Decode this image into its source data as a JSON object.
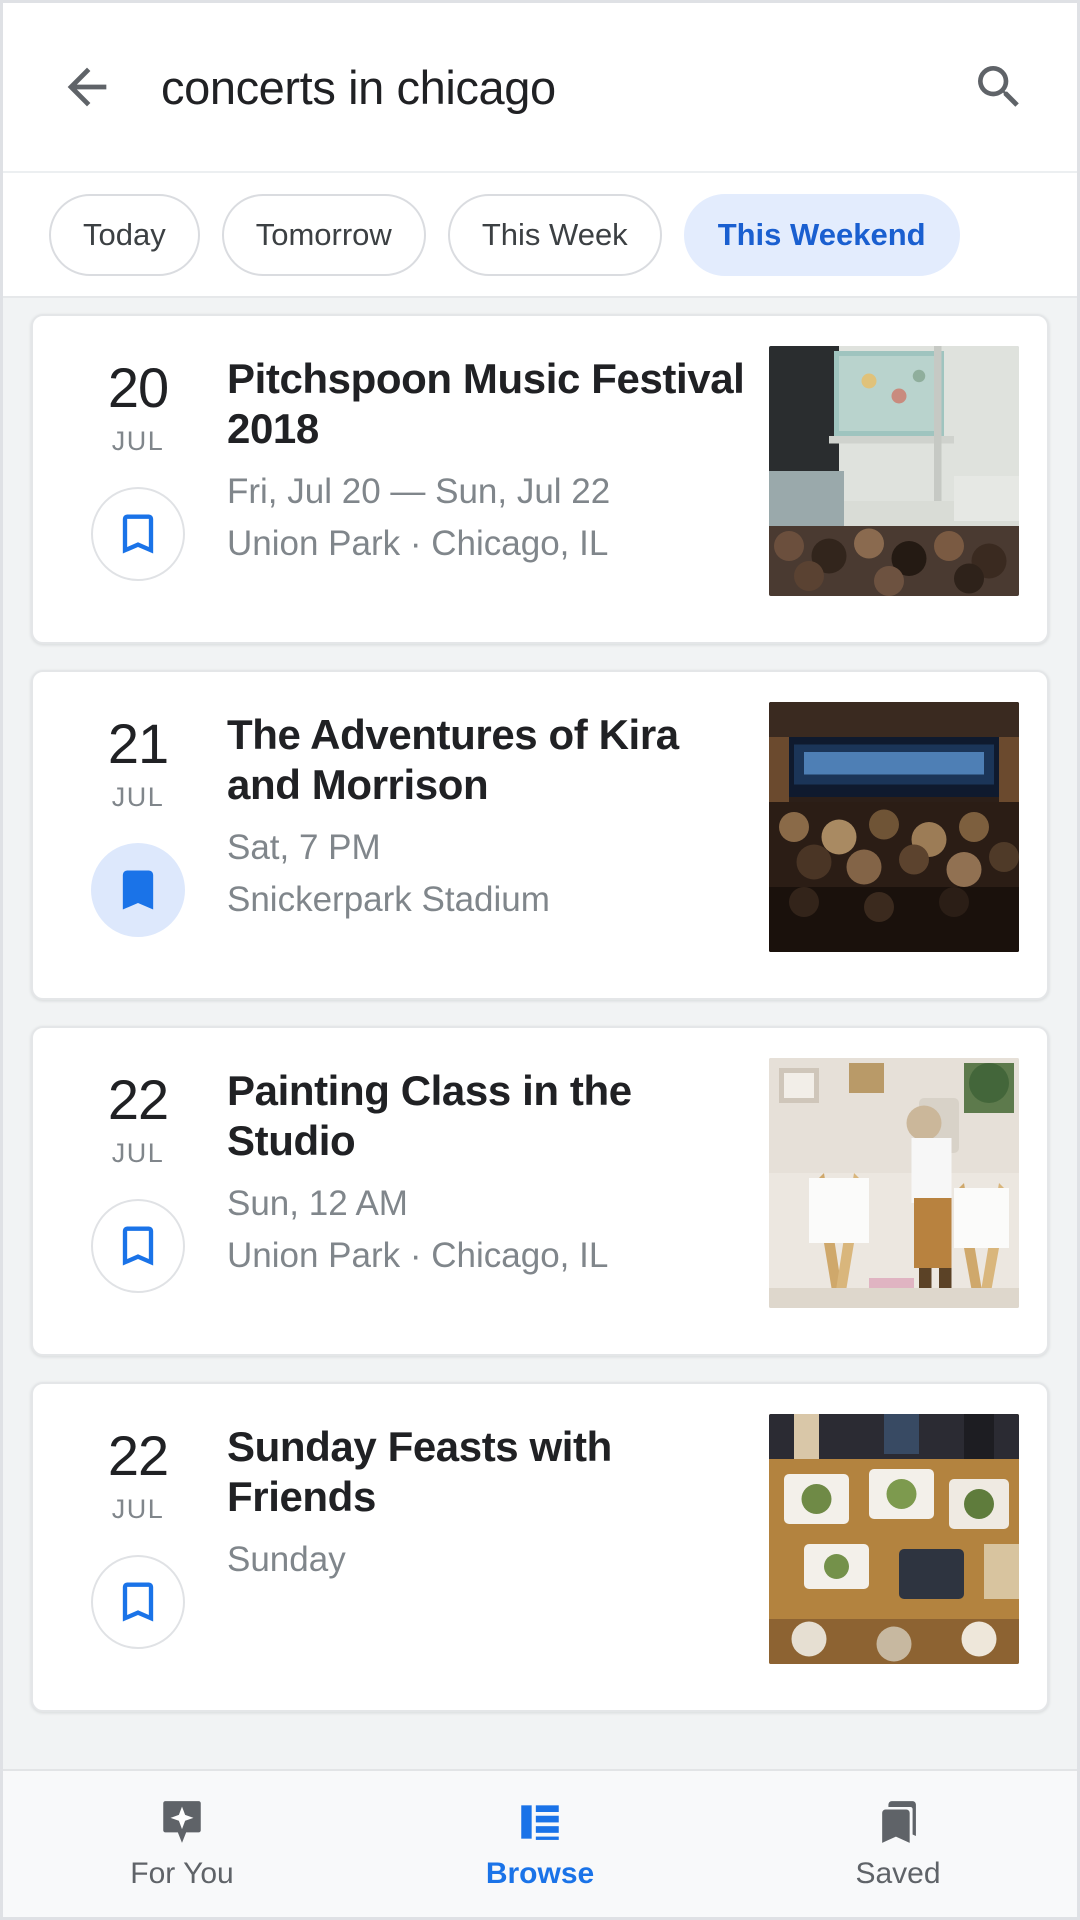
{
  "search": {
    "query": "concerts in chicago",
    "back_icon": "arrow-left-icon",
    "search_icon": "search-icon"
  },
  "filters": {
    "chips": [
      {
        "label": "Today",
        "selected": false
      },
      {
        "label": "Tomorrow",
        "selected": false
      },
      {
        "label": "This Week",
        "selected": false
      },
      {
        "label": "This Weekend",
        "selected": true
      }
    ]
  },
  "events": [
    {
      "day": "20",
      "month": "JUL",
      "title": "Pitchspoon Music Festival 2018",
      "when": "Fri, Jul 20 — Sun, Jul 22",
      "where": "Union Park · Chicago, IL",
      "saved": false,
      "thumb": "music-festival-crowd-photo"
    },
    {
      "day": "21",
      "month": "JUL",
      "title": "The Adventures of Kira and Morrison",
      "when": "Sat, 7 PM",
      "where": "Snickerpark Stadium",
      "saved": true,
      "thumb": "concert-hall-audience-photo"
    },
    {
      "day": "22",
      "month": "JUL",
      "title": "Painting Class in the Studio",
      "when": "Sun, 12 AM",
      "where": "Union Park · Chicago, IL",
      "saved": false,
      "thumb": "painting-studio-easel-photo"
    },
    {
      "day": "22",
      "month": "JUL",
      "title": "Sunday Feasts with Friends",
      "when": "Sunday",
      "where": "",
      "saved": false,
      "thumb": "dinner-table-food-photo"
    }
  ],
  "bottom_nav": {
    "items": [
      {
        "label": "For You",
        "icon": "sparkle-bubble-icon",
        "active": false
      },
      {
        "label": "Browse",
        "icon": "list-icon",
        "active": true
      },
      {
        "label": "Saved",
        "icon": "bookmarks-stack-icon",
        "active": false
      }
    ]
  },
  "colors": {
    "accent_blue": "#1a73e8",
    "chip_selected_bg": "#e3ecfd",
    "chip_selected_text": "#1a5fd0",
    "saved_bookmark_bg": "#dde8fc",
    "title_text": "#202124",
    "secondary_text": "#80868b"
  }
}
